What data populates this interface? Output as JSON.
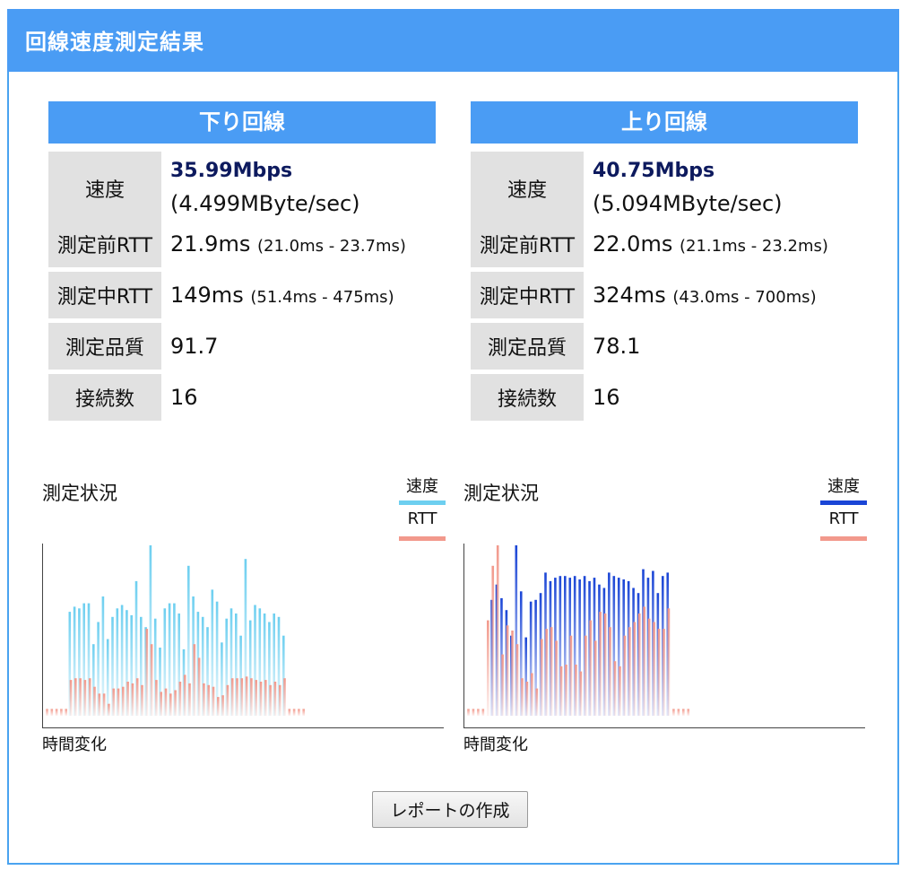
{
  "page": {
    "title": "回線速度測定結果"
  },
  "download": {
    "heading": "下り回線",
    "rows": {
      "speed_label": "速度",
      "speed_value": "35.99Mbps",
      "speed_sub": "(4.499MByte/sec)",
      "rtt_before_label": "測定前RTT",
      "rtt_before_value": "21.9ms",
      "rtt_before_range": "(21.0ms - 23.7ms)",
      "rtt_during_label": "測定中RTT",
      "rtt_during_value": "149ms",
      "rtt_during_range": "(51.4ms - 475ms)",
      "quality_label": "測定品質",
      "quality_value": "91.7",
      "connections_label": "接続数",
      "connections_value": "16"
    },
    "chart": {
      "title": "測定状況",
      "legend_speed": "速度",
      "legend_rtt": "RTT",
      "xlabel": "時間変化"
    }
  },
  "upload": {
    "heading": "上り回線",
    "rows": {
      "speed_label": "速度",
      "speed_value": "40.75Mbps",
      "speed_sub": "(5.094MByte/sec)",
      "rtt_before_label": "測定前RTT",
      "rtt_before_value": "22.0ms",
      "rtt_before_range": "(21.1ms - 23.2ms)",
      "rtt_during_label": "測定中RTT",
      "rtt_during_value": "324ms",
      "rtt_during_range": "(43.0ms - 700ms)",
      "quality_label": "測定品質",
      "quality_value": "78.1",
      "connections_label": "接続数",
      "connections_value": "16"
    },
    "chart": {
      "title": "測定状況",
      "legend_speed": "速度",
      "legend_rtt": "RTT",
      "xlabel": "時間変化"
    }
  },
  "buttons": {
    "report": "レポートの作成"
  },
  "colors": {
    "accent": "#4a9cf4",
    "download_speed": "#6dcff0",
    "upload_speed": "#1a45d6",
    "rtt": "#f2998c"
  },
  "chart_data": [
    {
      "type": "bar",
      "id": "download",
      "xlabel": "時間変化",
      "series": [
        {
          "name": "速度",
          "values": [
            0,
            0,
            0,
            0,
            0,
            0.61,
            0.64,
            0.63,
            0.66,
            0.66,
            0.42,
            0.55,
            0.7,
            0.45,
            0.58,
            0.63,
            0.65,
            0.62,
            0.59,
            0.79,
            0.58,
            0.52,
            1.0,
            0.57,
            0.4,
            0.63,
            0.66,
            0.66,
            0.6,
            0.39,
            0.88,
            0.7,
            0.61,
            0.58,
            0.52,
            0.74,
            0.67,
            0.43,
            0.57,
            0.63,
            0.6,
            0.47,
            0.92,
            0.56,
            0.65,
            0.63,
            0.6,
            0.55,
            0.6,
            0.58,
            0.47,
            0,
            0,
            0,
            0
          ]
        },
        {
          "name": "RTT",
          "values": [
            0.04,
            0.04,
            0.04,
            0.04,
            0.04,
            0.21,
            0.22,
            0.22,
            0.21,
            0.22,
            0.17,
            0.13,
            0.13,
            0.07,
            0.16,
            0.16,
            0.17,
            0.2,
            0.19,
            0.22,
            0.18,
            0.51,
            0.42,
            0.21,
            0.14,
            0.16,
            0.13,
            0.15,
            0.2,
            0.24,
            0.19,
            0.42,
            0.34,
            0.19,
            0.18,
            0.17,
            0.11,
            0.12,
            0.18,
            0.22,
            0.22,
            0.22,
            0.23,
            0.22,
            0.21,
            0.2,
            0.21,
            0.18,
            0.2,
            0.18,
            0.22,
            0.04,
            0.04,
            0.04,
            0.04
          ]
        }
      ]
    },
    {
      "type": "bar",
      "id": "upload",
      "xlabel": "時間変化",
      "series": [
        {
          "name": "速度",
          "values": [
            0,
            0,
            0,
            0,
            0,
            0.68,
            0.77,
            0.69,
            0.62,
            0.47,
            1.0,
            0.73,
            0.46,
            0.67,
            0.68,
            0.72,
            0.84,
            0.79,
            0.81,
            0.82,
            0.82,
            0.81,
            0.82,
            0.8,
            0.82,
            0.79,
            0.81,
            0.77,
            0.75,
            0.84,
            0.82,
            0.81,
            0.8,
            0.79,
            0.75,
            0.72,
            0.86,
            0.81,
            0.85,
            0.72,
            0.82,
            0.84,
            0.0,
            0,
            0,
            0,
            0
          ]
        },
        {
          "name": "RTT",
          "values": [
            0.04,
            0.04,
            0.04,
            0.04,
            0.56,
            0.88,
            1.0,
            0.36,
            0.53,
            0.5,
            0.42,
            0.22,
            0.2,
            0.25,
            0.16,
            0.45,
            0.51,
            0.52,
            0.44,
            0.29,
            0.3,
            0.47,
            0.3,
            0.26,
            0.47,
            0.56,
            0.44,
            0.61,
            0.6,
            0.52,
            0.32,
            0.29,
            0.47,
            0.52,
            0.55,
            0.6,
            0.64,
            0.57,
            0.55,
            0.51,
            0.51,
            0.63,
            0.04,
            0.04,
            0.04,
            0.04
          ]
        }
      ]
    }
  ]
}
